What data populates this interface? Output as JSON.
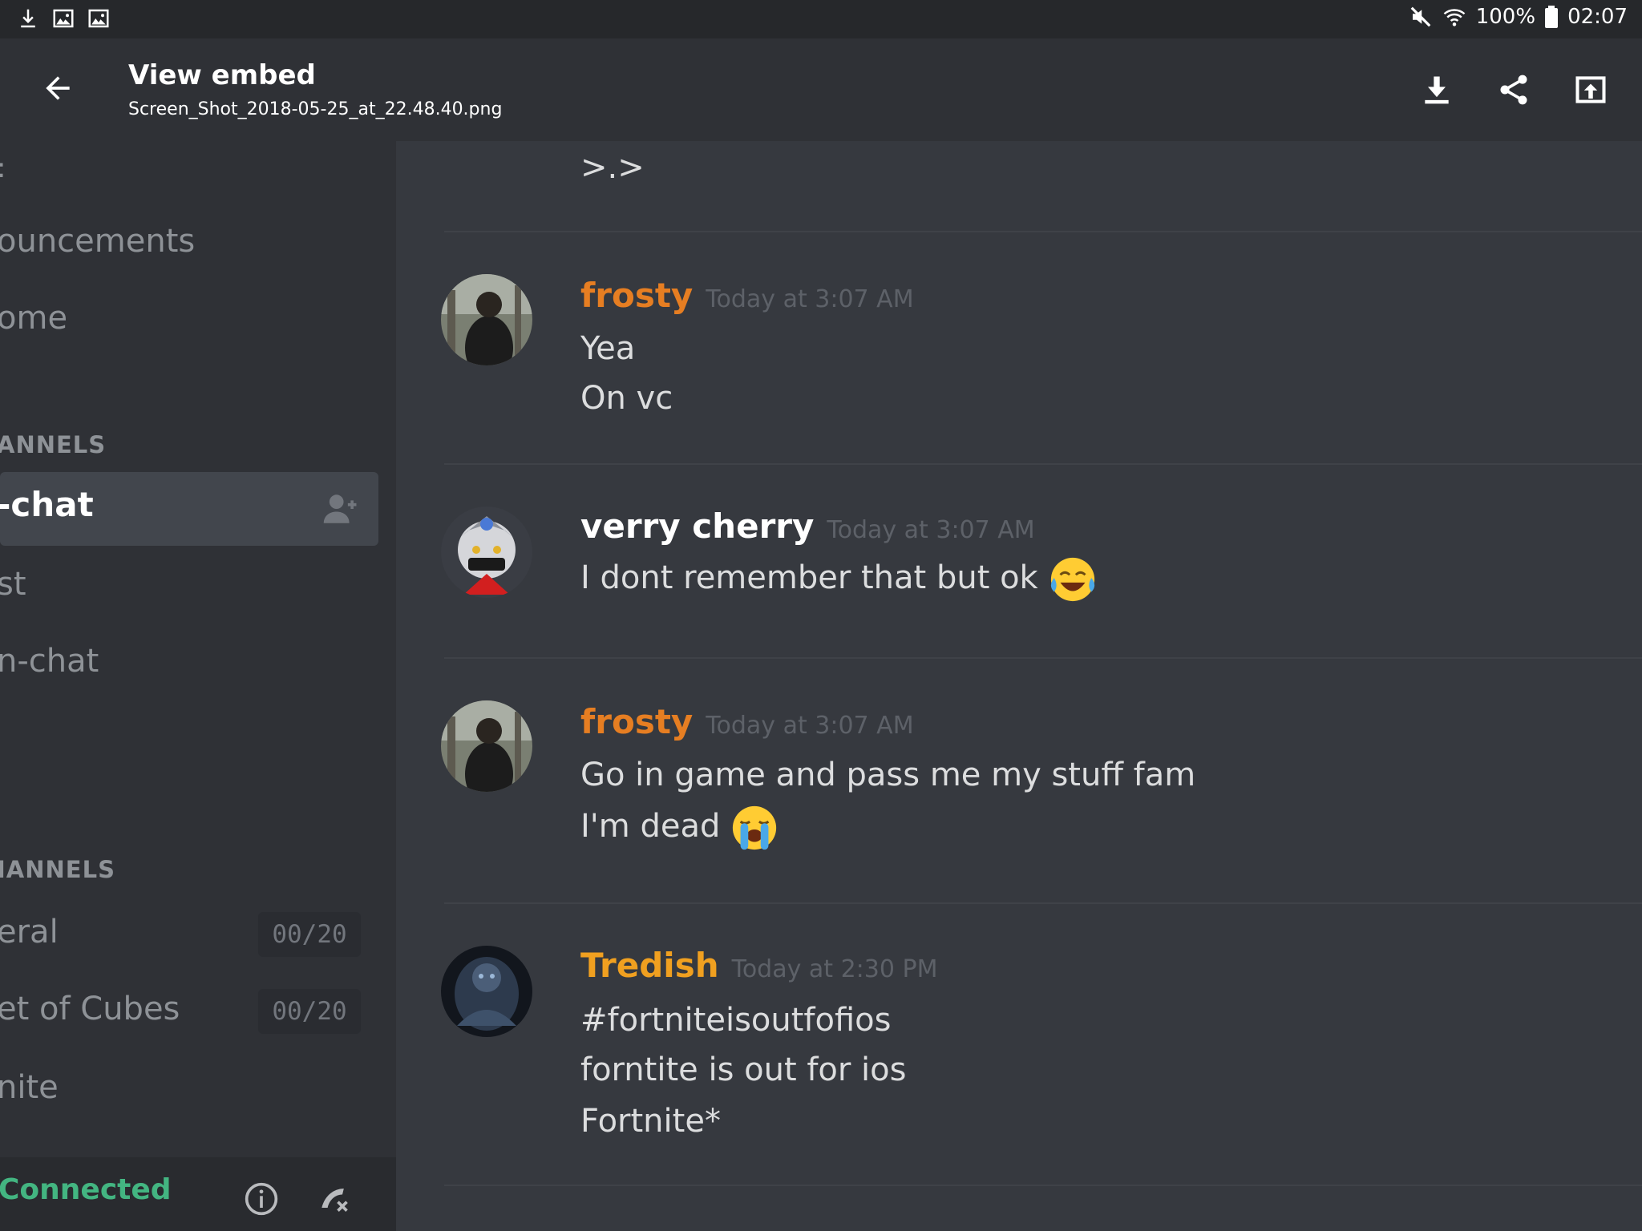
{
  "status_bar": {
    "battery": "100%",
    "time": "02:07"
  },
  "app_bar": {
    "title": "View embed",
    "filename": "Screen_Shot_2018-05-25_at_22.48.40.png"
  },
  "sidebar": {
    "top_fragment": ":",
    "text_items": [
      {
        "label": "ouncements"
      },
      {
        "label": "ome"
      }
    ],
    "category_text": "ANNELS",
    "active_channel": "-chat",
    "more_items": [
      {
        "label": "st"
      },
      {
        "label": "n-chat"
      }
    ],
    "category_voice": "IANNELS",
    "voice_channels": [
      {
        "label": "eral",
        "count": "00/20"
      },
      {
        "label": "et of Cubes",
        "count": "00/20"
      },
      {
        "label": "nite"
      }
    ],
    "connection_status": "Connected"
  },
  "chat": {
    "top_message": ">.>",
    "messages": [
      {
        "author": "frosty",
        "time": "Today at 3:07 AM",
        "color": "#e67e22",
        "lines": [
          "Yea",
          "On vc"
        ]
      },
      {
        "author": "verry cherry",
        "time": "Today at 3:07 AM",
        "color": "#ffffff",
        "lines": [
          "I dont remember that but ok"
        ],
        "emoji": "tears-of-joy-emoji"
      },
      {
        "author": "frosty",
        "time": "Today at 3:07 AM",
        "color": "#e67e22",
        "lines": [
          "Go in game and pass me my stuff fam",
          "I'm dead"
        ],
        "emoji": "loudly-crying-emoji"
      },
      {
        "author": "Tredish",
        "time": "Today at 2:30 PM",
        "color": "#f0a020",
        "lines": [
          "#fortniteisoutfofios",
          "forntite is out for ios",
          "Fortnite*"
        ]
      }
    ]
  },
  "icons": {
    "status_left": [
      "download-icon",
      "image-icon",
      "image-icon"
    ],
    "status_right": [
      "mute-icon",
      "wifi-icon",
      "battery-icon"
    ],
    "app_bar": [
      "back-arrow-icon",
      "download-icon",
      "share-icon",
      "open-external-icon"
    ],
    "sidebar": [
      "add-user-icon",
      "info-icon",
      "disconnect-icon"
    ]
  }
}
